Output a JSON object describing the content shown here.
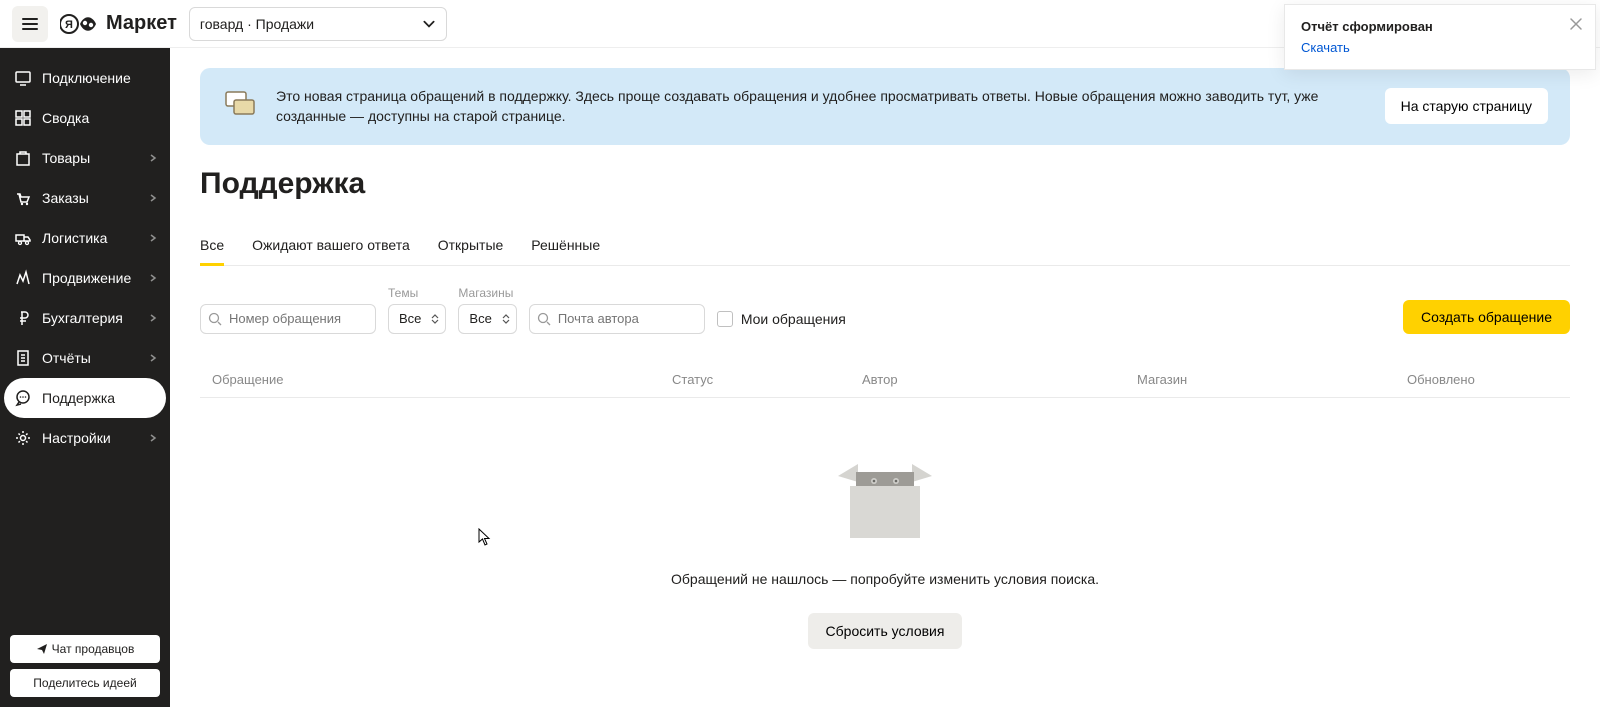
{
  "header": {
    "logo_text": "Маркет",
    "shop_selected": "говард · Продажи"
  },
  "toast": {
    "title": "Отчёт сформирован",
    "link": "Скачать"
  },
  "sidebar": {
    "items": [
      {
        "label": "Подключение",
        "icon": "connect",
        "chev": false
      },
      {
        "label": "Сводка",
        "icon": "dashboard",
        "chev": false
      },
      {
        "label": "Товары",
        "icon": "goods",
        "chev": true
      },
      {
        "label": "Заказы",
        "icon": "orders",
        "chev": true
      },
      {
        "label": "Логистика",
        "icon": "truck",
        "chev": true
      },
      {
        "label": "Продвижение",
        "icon": "promo",
        "chev": true
      },
      {
        "label": "Бухгалтерия",
        "icon": "ruble",
        "chev": true
      },
      {
        "label": "Отчёты",
        "icon": "reports",
        "chev": true
      },
      {
        "label": "Поддержка",
        "icon": "support",
        "chev": false,
        "active": true
      },
      {
        "label": "Настройки",
        "icon": "gear",
        "chev": true
      }
    ],
    "chat_btn": "Чат продавцов",
    "idea_btn": "Поделитесь идеей"
  },
  "banner": {
    "text": "Это новая страница обращений в поддержку. Здесь проще создавать обращения и удобнее просматривать ответы. Новые обращения можно заводить тут, уже созданные — доступны на старой странице.",
    "btn": "На старую страницу"
  },
  "page": {
    "title": "Поддержка"
  },
  "tabs": [
    {
      "label": "Все",
      "active": true
    },
    {
      "label": "Ожидают вашего ответа"
    },
    {
      "label": "Открытые"
    },
    {
      "label": "Решённые"
    }
  ],
  "filters": {
    "ticket_placeholder": "Номер обращения",
    "topics_label": "Темы",
    "topics_value": "Все",
    "shops_label": "Магазины",
    "shops_value": "Все",
    "author_placeholder": "Почта автора",
    "mine_label": "Мои обращения",
    "create_btn": "Создать обращение"
  },
  "table": {
    "cols": [
      "Обращение",
      "Статус",
      "Автор",
      "Магазин",
      "Обновлено"
    ]
  },
  "empty": {
    "text": "Обращений не нашлось — попробуйте изменить условия поиска.",
    "reset_btn": "Сбросить условия"
  }
}
